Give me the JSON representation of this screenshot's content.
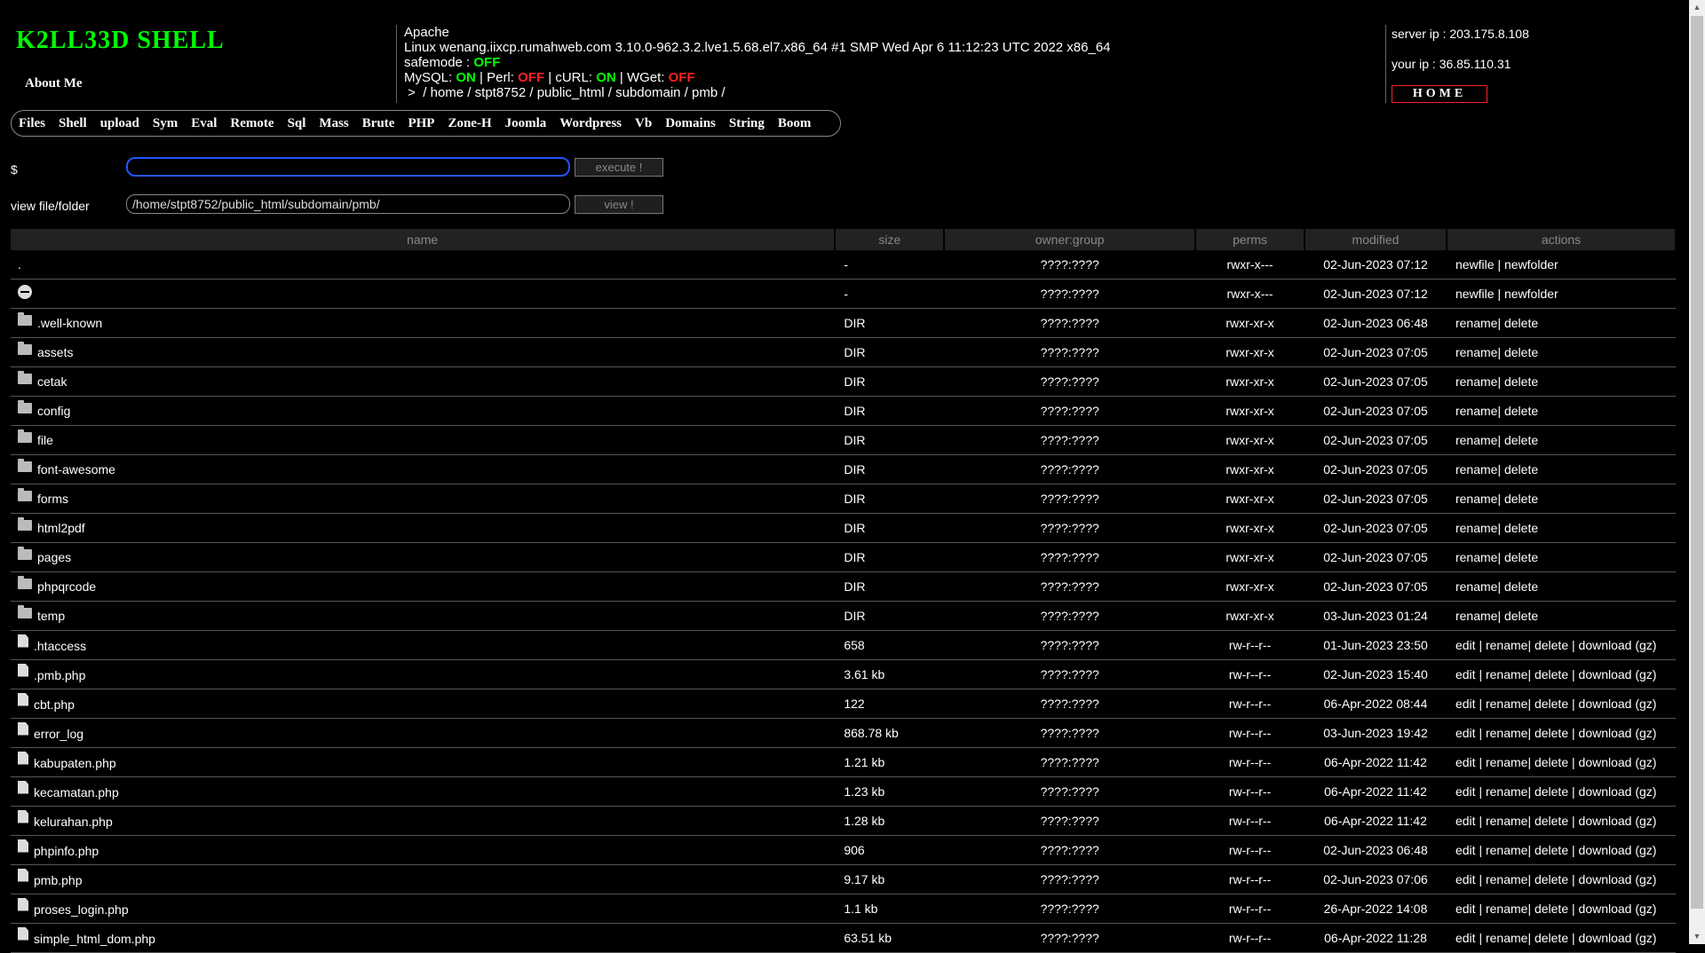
{
  "header": {
    "logo": "K2LL33D SHELL",
    "about": "About Me",
    "server_software": "Apache",
    "uname": "Linux wenang.iixcp.rumahweb.com 3.10.0-962.3.2.lve1.5.68.el7.x86_64 #1 SMP Wed Apr 6 11:12:23 UTC 2022 x86_64",
    "safemode_label": "safemode :",
    "safemode_value": "OFF",
    "mysql_label": "MySQL:",
    "mysql_value": "ON",
    "perl_label": "Perl:",
    "perl_value": "OFF",
    "curl_label": "cURL:",
    "curl_value": "ON",
    "wget_label": "WGet:",
    "wget_value": "OFF",
    "path_prefix": ">",
    "path_parts": [
      "home",
      "stpt8752",
      "public_html",
      "subdomain",
      "pmb"
    ],
    "server_ip": "server ip : 203.175.8.108",
    "your_ip": "your ip : 36.85.110.31",
    "home_button": "HOME",
    "colors": {
      "logo": "#00ff00",
      "on": "#00ff00",
      "off": "#ff2020"
    }
  },
  "menu": [
    "Files",
    "Shell",
    "upload",
    "Sym",
    "Eval",
    "Remote",
    "Sql",
    "Mass",
    "Brute",
    "PHP",
    "Zone-H",
    "Joomla",
    "Wordpress",
    "Vb",
    "Domains",
    "String",
    "Boom"
  ],
  "command": {
    "label": "$",
    "value": "",
    "button": "execute !"
  },
  "view": {
    "label": "view file/folder",
    "value": "/home/stpt8752/public_html/subdomain/pmb/",
    "button": "view !"
  },
  "table": {
    "headers": [
      "name",
      "size",
      "owner:group",
      "perms",
      "modified",
      "actions"
    ],
    "rows": [
      {
        "icon": "none",
        "name": ".",
        "size": "-",
        "owner": "????:????",
        "perms": "rwxr-x---",
        "modified": "02-Jun-2023 07:12",
        "actions": "newfile | newfolder"
      },
      {
        "icon": "parent-dir-icon",
        "name": "",
        "size": "-",
        "owner": "????:????",
        "perms": "rwxr-x---",
        "modified": "02-Jun-2023 07:12",
        "actions": "newfile | newfolder"
      },
      {
        "icon": "folder-icon",
        "name": ".well-known",
        "size": "DIR",
        "owner": "????:????",
        "perms": "rwxr-xr-x",
        "modified": "02-Jun-2023 06:48",
        "actions": "rename| delete"
      },
      {
        "icon": "folder-icon",
        "name": "assets",
        "size": "DIR",
        "owner": "????:????",
        "perms": "rwxr-xr-x",
        "modified": "02-Jun-2023 07:05",
        "actions": "rename| delete"
      },
      {
        "icon": "folder-icon",
        "name": "cetak",
        "size": "DIR",
        "owner": "????:????",
        "perms": "rwxr-xr-x",
        "modified": "02-Jun-2023 07:05",
        "actions": "rename| delete"
      },
      {
        "icon": "folder-icon",
        "name": "config",
        "size": "DIR",
        "owner": "????:????",
        "perms": "rwxr-xr-x",
        "modified": "02-Jun-2023 07:05",
        "actions": "rename| delete"
      },
      {
        "icon": "folder-icon",
        "name": "file",
        "size": "DIR",
        "owner": "????:????",
        "perms": "rwxr-xr-x",
        "modified": "02-Jun-2023 07:05",
        "actions": "rename| delete"
      },
      {
        "icon": "folder-icon",
        "name": "font-awesome",
        "size": "DIR",
        "owner": "????:????",
        "perms": "rwxr-xr-x",
        "modified": "02-Jun-2023 07:05",
        "actions": "rename| delete"
      },
      {
        "icon": "folder-icon",
        "name": "forms",
        "size": "DIR",
        "owner": "????:????",
        "perms": "rwxr-xr-x",
        "modified": "02-Jun-2023 07:05",
        "actions": "rename| delete"
      },
      {
        "icon": "folder-icon",
        "name": "html2pdf",
        "size": "DIR",
        "owner": "????:????",
        "perms": "rwxr-xr-x",
        "modified": "02-Jun-2023 07:05",
        "actions": "rename| delete"
      },
      {
        "icon": "folder-icon",
        "name": "pages",
        "size": "DIR",
        "owner": "????:????",
        "perms": "rwxr-xr-x",
        "modified": "02-Jun-2023 07:05",
        "actions": "rename| delete"
      },
      {
        "icon": "folder-icon",
        "name": "phpqrcode",
        "size": "DIR",
        "owner": "????:????",
        "perms": "rwxr-xr-x",
        "modified": "02-Jun-2023 07:05",
        "actions": "rename| delete"
      },
      {
        "icon": "folder-icon",
        "name": "temp",
        "size": "DIR",
        "owner": "????:????",
        "perms": "rwxr-xr-x",
        "modified": "03-Jun-2023 01:24",
        "actions": "rename| delete"
      },
      {
        "icon": "file-icon",
        "name": ".htaccess",
        "size": "658",
        "owner": "????:????",
        "perms": "rw-r--r--",
        "modified": "01-Jun-2023 23:50",
        "actions": "edit | rename| delete | download (gz)"
      },
      {
        "icon": "file-icon",
        "name": ".pmb.php",
        "size": "3.61 kb",
        "owner": "????:????",
        "perms": "rw-r--r--",
        "modified": "02-Jun-2023 15:40",
        "actions": "edit | rename| delete | download (gz)"
      },
      {
        "icon": "file-icon",
        "name": "cbt.php",
        "size": "122",
        "owner": "????:????",
        "perms": "rw-r--r--",
        "modified": "06-Apr-2022 08:44",
        "actions": "edit | rename| delete | download (gz)"
      },
      {
        "icon": "file-icon",
        "name": "error_log",
        "size": "868.78 kb",
        "owner": "????:????",
        "perms": "rw-r--r--",
        "modified": "03-Jun-2023 19:42",
        "actions": "edit | rename| delete | download (gz)"
      },
      {
        "icon": "file-icon",
        "name": "kabupaten.php",
        "size": "1.21 kb",
        "owner": "????:????",
        "perms": "rw-r--r--",
        "modified": "06-Apr-2022 11:42",
        "actions": "edit | rename| delete | download (gz)"
      },
      {
        "icon": "file-icon",
        "name": "kecamatan.php",
        "size": "1.23 kb",
        "owner": "????:????",
        "perms": "rw-r--r--",
        "modified": "06-Apr-2022 11:42",
        "actions": "edit | rename| delete | download (gz)"
      },
      {
        "icon": "file-icon",
        "name": "kelurahan.php",
        "size": "1.28 kb",
        "owner": "????:????",
        "perms": "rw-r--r--",
        "modified": "06-Apr-2022 11:42",
        "actions": "edit | rename| delete | download (gz)"
      },
      {
        "icon": "file-icon",
        "name": "phpinfo.php",
        "size": "906",
        "owner": "????:????",
        "perms": "rw-r--r--",
        "modified": "02-Jun-2023 06:48",
        "actions": "edit | rename| delete | download (gz)"
      },
      {
        "icon": "file-icon",
        "name": "pmb.php",
        "size": "9.17 kb",
        "owner": "????:????",
        "perms": "rw-r--r--",
        "modified": "02-Jun-2023 07:06",
        "actions": "edit | rename| delete | download (gz)"
      },
      {
        "icon": "file-icon",
        "name": "proses_login.php",
        "size": "1.1 kb",
        "owner": "????:????",
        "perms": "rw-r--r--",
        "modified": "26-Apr-2022 14:08",
        "actions": "edit | rename| delete | download (gz)"
      },
      {
        "icon": "file-icon",
        "name": "simple_html_dom.php",
        "size": "63.51 kb",
        "owner": "????:????",
        "perms": "rw-r--r--",
        "modified": "06-Apr-2022 11:28",
        "actions": "edit | rename| delete | download (gz)"
      }
    ]
  }
}
